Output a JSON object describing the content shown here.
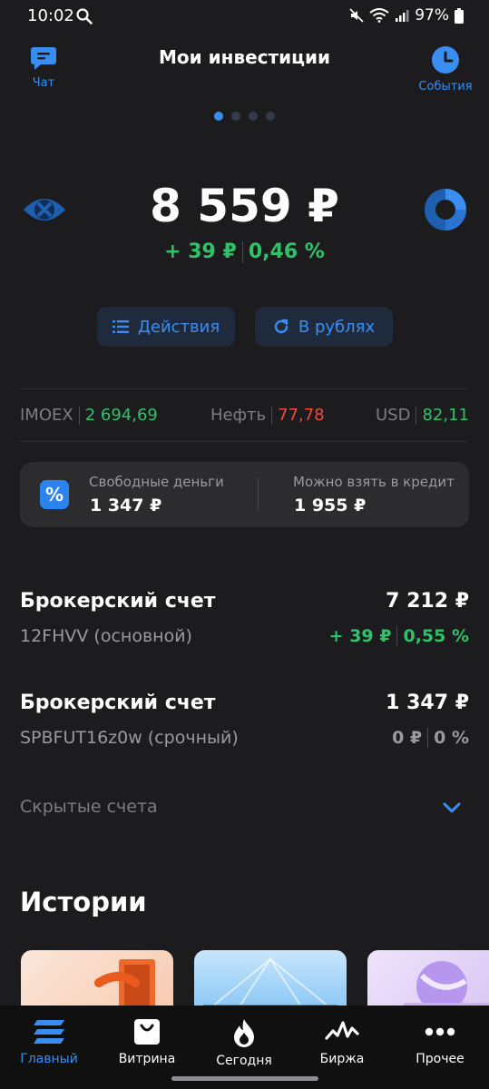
{
  "status_bar": {
    "time": "10:02",
    "battery": "97%"
  },
  "header": {
    "title": "Мои инвестиции",
    "chat_label": "Чат",
    "events_label": "События"
  },
  "portfolio": {
    "balance": "8 559 ₽",
    "change_abs": "+ 39 ₽",
    "change_pct": "0,46 %"
  },
  "actions": {
    "actions_label": "Действия",
    "currency_label": "В рублях"
  },
  "tickers": [
    {
      "name": "IMOEX",
      "value": "2 694,69",
      "color": "#2fc26a"
    },
    {
      "name": "Нефть",
      "value": "77,78",
      "color": "#f24a3a"
    },
    {
      "name": "USD",
      "value": "82,11",
      "color": "#2fc26a"
    }
  ],
  "money": {
    "free_label": "Свободные деньги",
    "free_value": "1 347 ₽",
    "credit_label": "Можно взять в кредит",
    "credit_value": "1 955 ₽",
    "icon_glyph": "%"
  },
  "accounts": [
    {
      "title": "Брокерский счет",
      "amount": "7 212 ₽",
      "subtitle": "12FHVV (основной)",
      "change_abs": "+ 39 ₽",
      "change_pct": "0,55 %",
      "change_color": "#2fc26a"
    },
    {
      "title": "Брокерский счет",
      "amount": "1 347 ₽",
      "subtitle": "SPBFUT16z0w (срочный)",
      "change_abs": "0 ₽",
      "change_pct": "0 %",
      "change_color": "#9a9a9f"
    }
  ],
  "hidden_accounts_label": "Скрытые счета",
  "stories_title": "Истории",
  "bottom_nav": [
    {
      "label": "Главный",
      "icon": "home-icon",
      "active": true
    },
    {
      "label": "Витрина",
      "icon": "bag-icon",
      "active": false
    },
    {
      "label": "Сегодня",
      "icon": "fire-icon",
      "active": false
    },
    {
      "label": "Биржа",
      "icon": "chart-icon",
      "active": false
    },
    {
      "label": "Прочее",
      "icon": "more-icon",
      "active": false
    }
  ],
  "colors": {
    "accent": "#3a8ef2",
    "positive": "#2fc26a",
    "negative": "#f24a3a",
    "background": "#1c1c1e"
  }
}
